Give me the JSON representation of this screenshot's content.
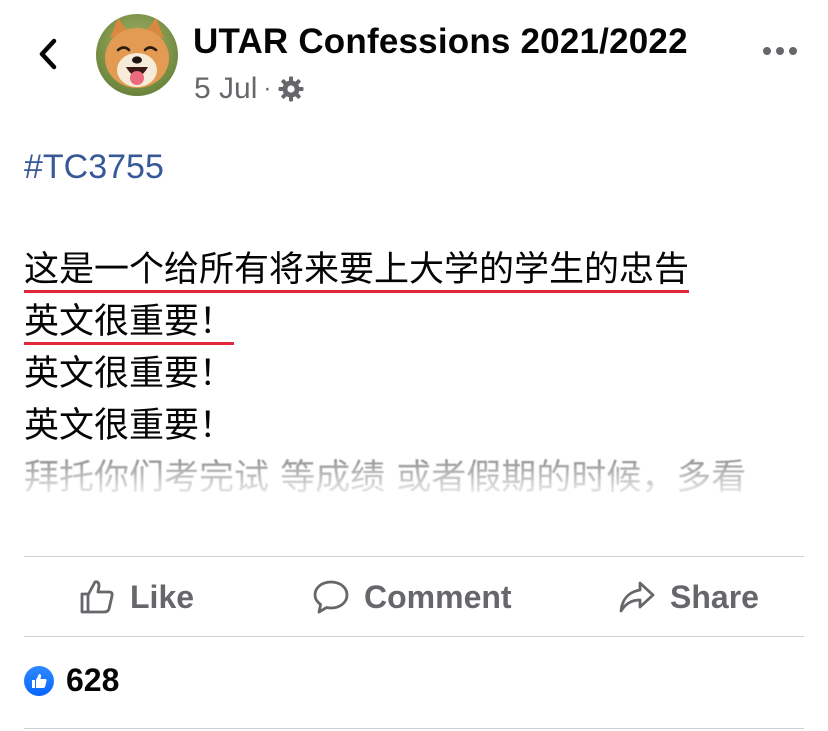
{
  "post": {
    "page_name": "UTAR Confessions 2021/2022",
    "date": "5 Jul",
    "separator": "·",
    "audience_icon": "gear-icon",
    "hashtag": "#TC3755",
    "lines": [
      "这是一个给所有将来要上大学的学生的忠告",
      "英文很重要！",
      "英文很重要！",
      "英文很重要！",
      " 拜托你们考完试 等成绩 或者假期的时候，多看"
    ]
  },
  "actions": {
    "like": "Like",
    "comment": "Comment",
    "share": "Share"
  },
  "reactions": {
    "count": "628",
    "icon": "thumbs-up-icon"
  },
  "colors": {
    "hashtag": "#385898",
    "secondary_text": "#65676b",
    "highlight_underline": "#e0283a",
    "like_blue": "#0866ff"
  }
}
